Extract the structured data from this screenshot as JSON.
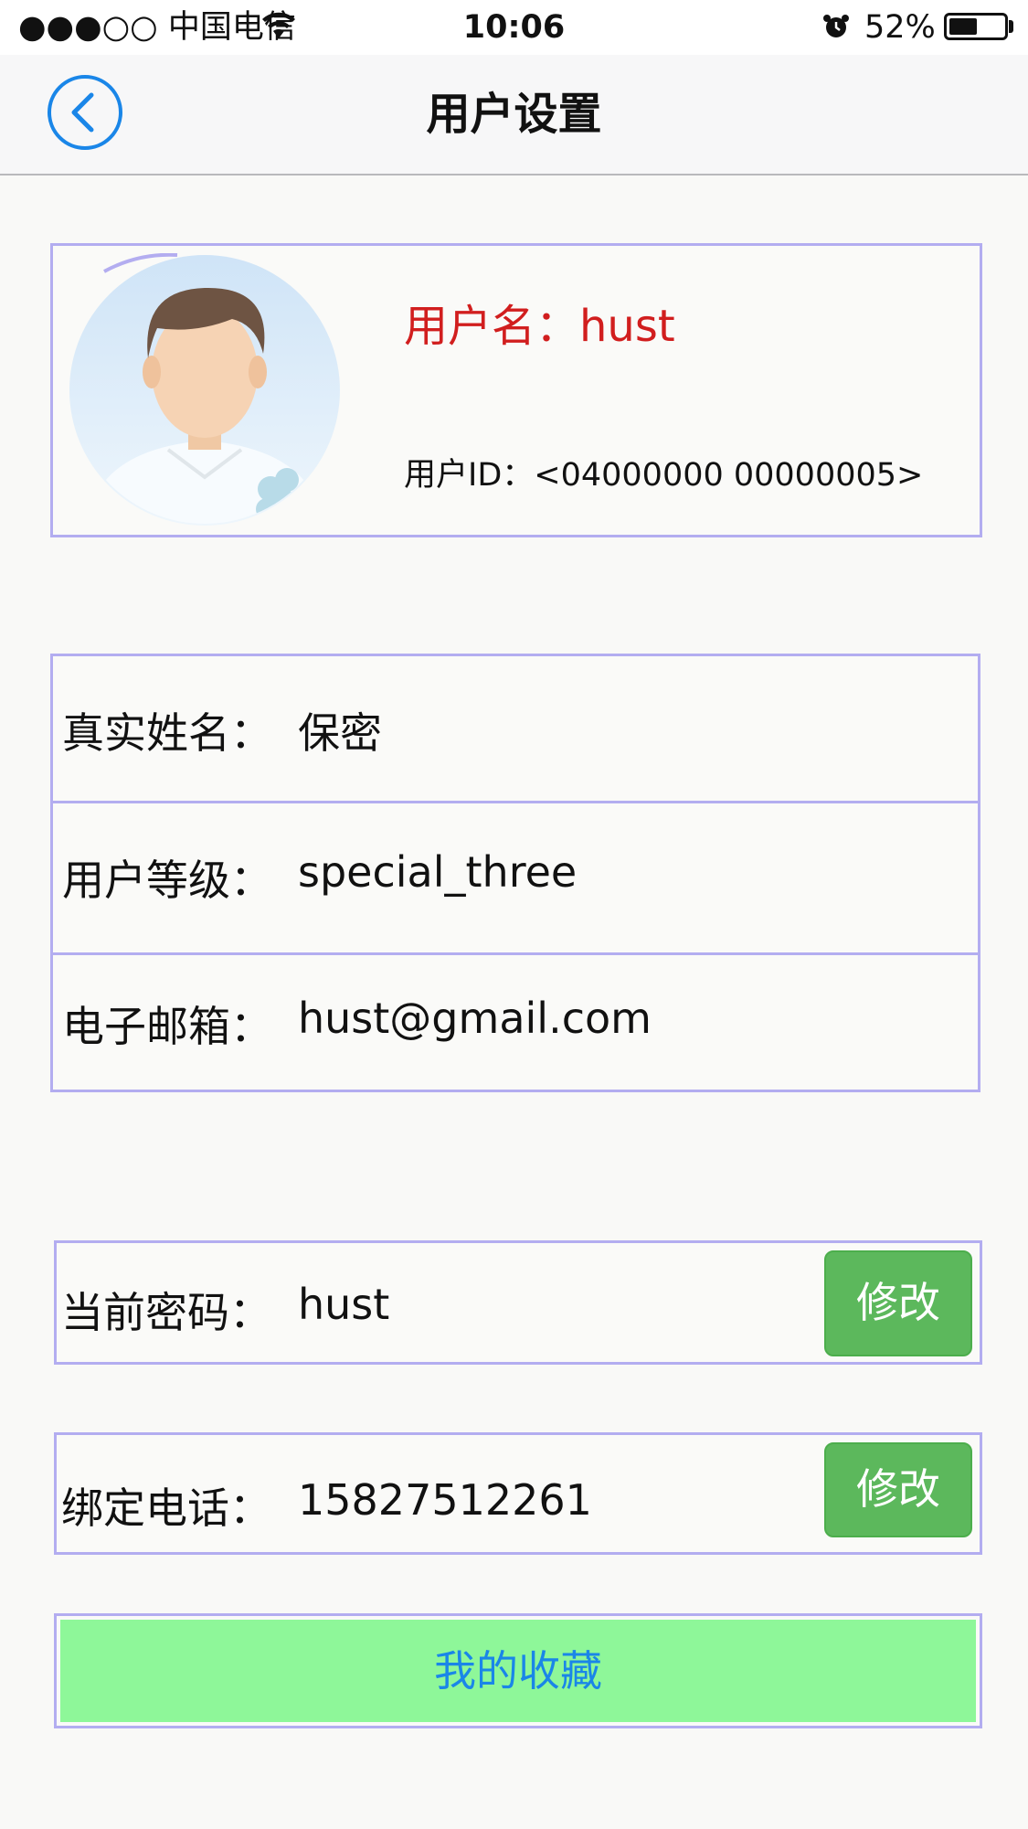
{
  "status_bar": {
    "carrier": "●●●○○ 中国电信",
    "time": "10:06",
    "battery": "52%",
    "icons": [
      "wifi-icon",
      "alarm-icon",
      "battery-icon"
    ]
  },
  "nav": {
    "title": "用户设置",
    "back_icon": "chevron-left-icon"
  },
  "profile": {
    "username_label": "用户名：hust",
    "user_id_label": "用户ID：<04000000 00000005>"
  },
  "info": {
    "rows": [
      {
        "label": "真实姓名：",
        "value": "保密"
      },
      {
        "label": "用户等级：",
        "value": "special_three"
      },
      {
        "label": "电子邮箱：",
        "value": "hust@gmail.com"
      }
    ]
  },
  "password": {
    "label": "当前密码：",
    "value": "hust",
    "button": "修改"
  },
  "phone": {
    "label": "绑定电话：",
    "value": "15827512261",
    "button": "修改"
  },
  "favorites": {
    "button": "我的收藏"
  },
  "colors": {
    "accent_blue": "#1a86e8",
    "username_red": "#d11e1e",
    "edit_green": "#5cb85c",
    "favorites_green": "#8ef799",
    "box_border": "#b3adf0"
  }
}
